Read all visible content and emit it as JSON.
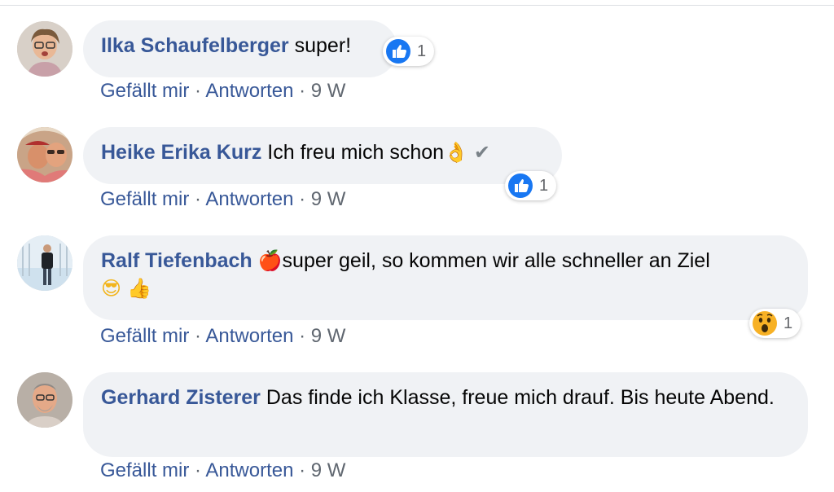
{
  "comments": [
    {
      "author": "Ilka Schaufelberger",
      "text": "super!",
      "like_label": "Gefällt mir",
      "separator": "·",
      "reply_label": "Antworten",
      "time": "9 W",
      "reaction_icon": "like-icon",
      "reaction_count": "1"
    },
    {
      "author": "Heike Erika Kurz",
      "text": "Ich freu mich schon",
      "emojis": [
        "👌",
        "✔"
      ],
      "like_label": "Gefällt mir",
      "separator": "·",
      "reply_label": "Antworten",
      "time": "9 W",
      "reaction_icon": "like-icon",
      "reaction_count": "1"
    },
    {
      "author": "Ralf Tiefenbach",
      "emoji_before": "🍎",
      "text": "super geil, so kommen wir alle schneller an Ziel",
      "emojis": [
        "😎",
        "👍"
      ],
      "like_label": "Gefällt mir",
      "separator": "·",
      "reply_label": "Antworten",
      "time": "9 W",
      "reaction_icon": "wow-icon",
      "reaction_count": "1"
    },
    {
      "author": "Gerhard Zisterer",
      "text": "Das finde ich Klasse, freue mich drauf. Bis heute Abend.",
      "like_label": "Gefällt mir",
      "separator": "·",
      "reply_label": "Antworten",
      "time": "9 W"
    }
  ],
  "colors": {
    "author": "#385898",
    "bubble": "#f0f2f5",
    "like_blue": "#1877f2",
    "meta_gray": "#606770"
  }
}
